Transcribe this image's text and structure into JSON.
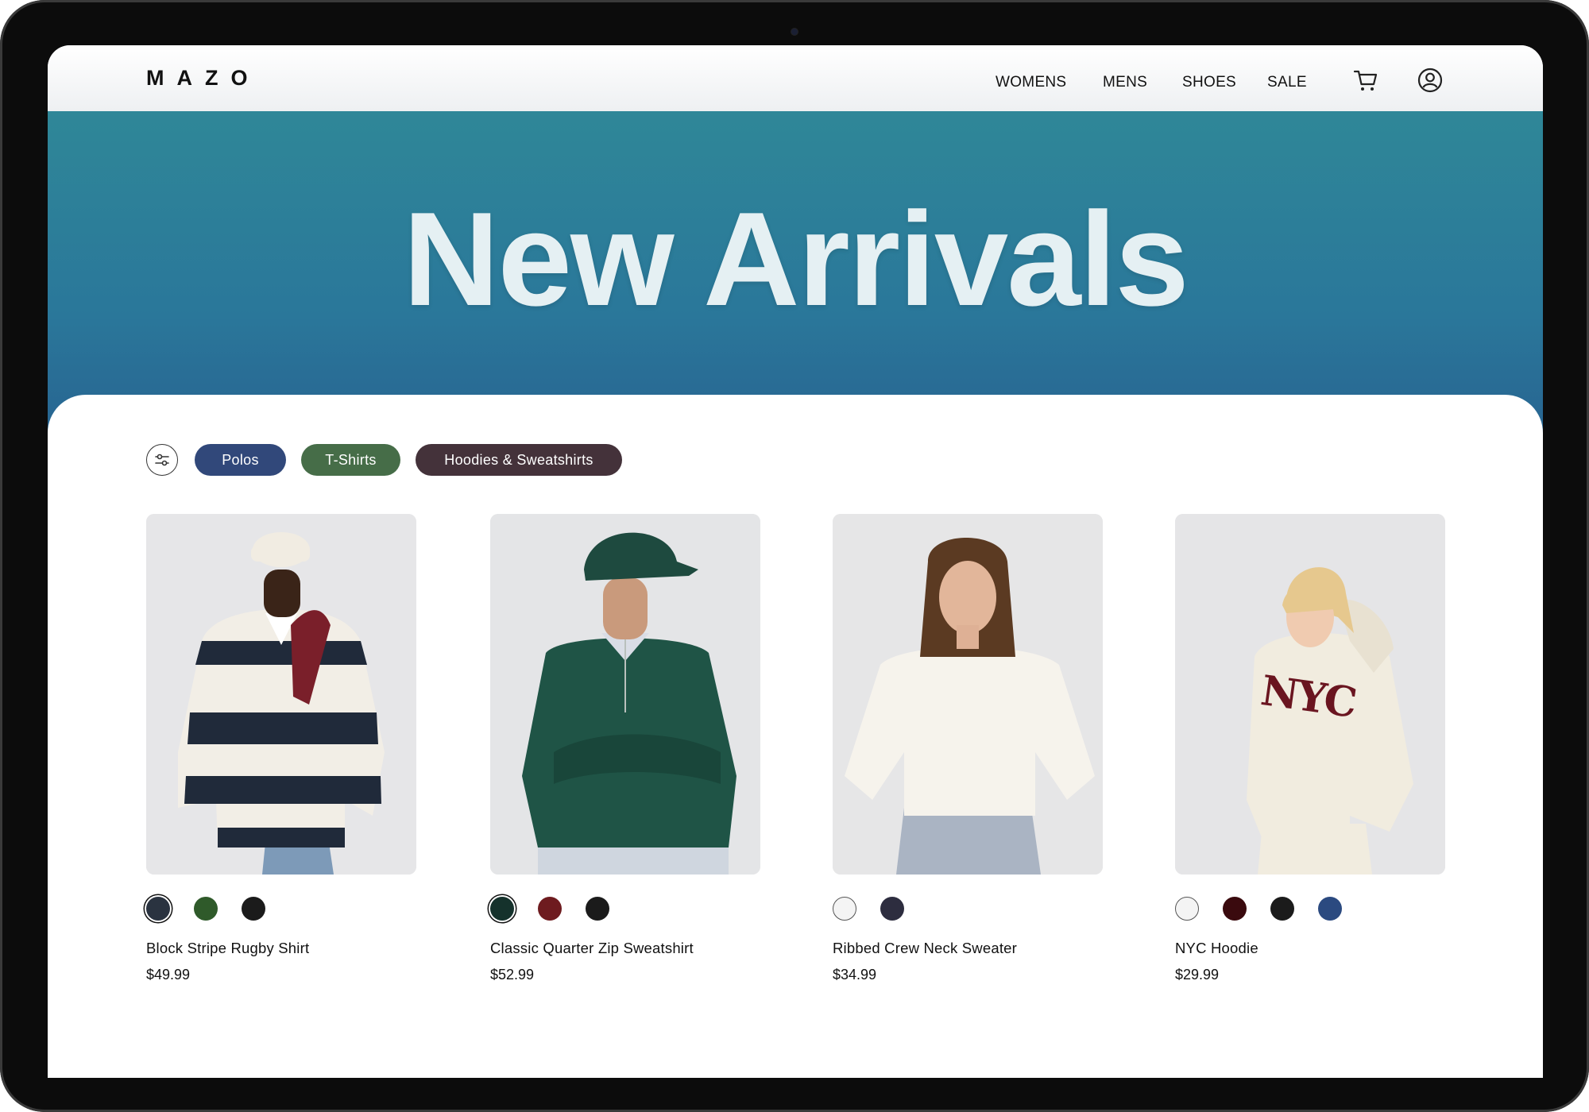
{
  "brand": {
    "logo": "MAZO"
  },
  "nav": {
    "links": [
      "WOMENS",
      "MENS",
      "SHOES",
      "SALE"
    ],
    "icons": [
      "cart-icon",
      "user-icon"
    ]
  },
  "hero": {
    "title": "New Arrivals"
  },
  "filters": {
    "icon": "sliders-icon",
    "chips": [
      {
        "label": "Polos",
        "color": "#31487a"
      },
      {
        "label": "T-Shirts",
        "color": "#466d48"
      },
      {
        "label": "Hoodies & Sweatshirts",
        "color": "#44323a"
      }
    ]
  },
  "products": [
    {
      "name": "Block Stripe Rugby Shirt",
      "price": "$49.99",
      "swatches": [
        "#2a3340",
        "#2f5a2a",
        "#1b1b1b"
      ],
      "selected_swatch": 0
    },
    {
      "name": "Classic Quarter Zip Sweatshirt",
      "price": "$52.99",
      "swatches": [
        "#15322c",
        "#6e1b1f",
        "#1b1b1b"
      ],
      "selected_swatch": 0
    },
    {
      "name": "Ribbed Crew Neck Sweater",
      "price": "$34.99",
      "swatches": [
        "#f4f4f4",
        "#2d2d3f"
      ],
      "selected_swatch": null
    },
    {
      "name": "NYC Hoodie",
      "price": "$29.99",
      "swatches": [
        "#f4f4f4",
        "#3a0a0e",
        "#1b1b1b",
        "#2b4a80"
      ],
      "selected_swatch": null
    }
  ]
}
